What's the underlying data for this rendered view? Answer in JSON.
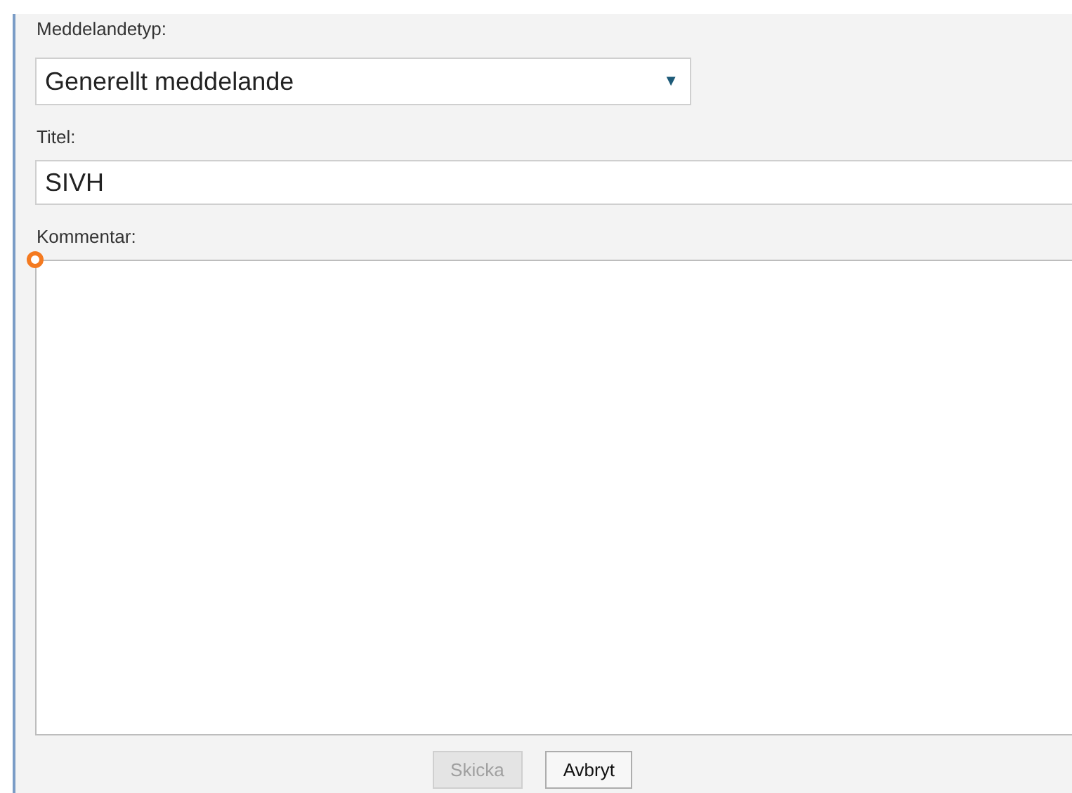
{
  "form": {
    "message_type": {
      "label": "Meddelandetyp:",
      "value": "Generellt meddelande",
      "arrow": "▼"
    },
    "title": {
      "label": "Titel:",
      "value": "SIVH"
    },
    "comment": {
      "label": "Kommentar:"
    }
  },
  "buttons": [
    {
      "label": "Skicka",
      "disabled": true
    },
    {
      "label": "Avbryt",
      "disabled": false
    }
  ]
}
